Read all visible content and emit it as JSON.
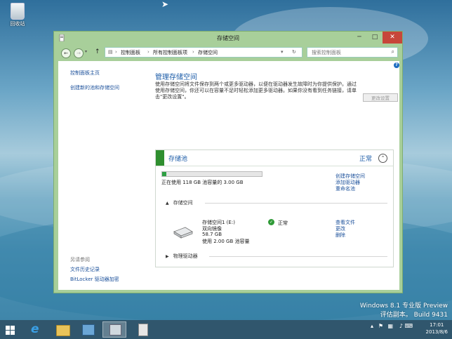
{
  "desktop": {
    "recycle_label": "回收站",
    "watermark_line1": "Windows 8.1 专业版 Preview",
    "watermark_line2": "评估副本。 Build 9431"
  },
  "window": {
    "title": "存储空间",
    "minimize": "─",
    "maximize": "□",
    "close": "✕"
  },
  "address": {
    "crumbs": [
      "控制面板",
      "所有控制面板项",
      "存储空间"
    ],
    "separator": "›",
    "search_placeholder": "搜索控制面板"
  },
  "sidebar": {
    "links": [
      "控制面板主页",
      "创建新的池和存储空间"
    ],
    "see_also_label": "另请参阅",
    "see_also_links": [
      "文件历史记录",
      "BitLocker 驱动器加密"
    ]
  },
  "main": {
    "heading": "管理存储空间",
    "description": "使用存储空间将文件保存到两个或更多驱动器，以便在驱动器发生故障时为你提供保护。通过使用存储空间，你还可以在容量不足时轻松添加更多驱动器。如果你没有看到任务链接，请单击\"更改设置\"。",
    "change_settings": "更改设置"
  },
  "pool": {
    "name": "存储池",
    "status": "正常",
    "usage_fraction": 0.04,
    "usage_text": "正在使用 118 GB 池容量的 3.00 GB",
    "actions": [
      "创建存储空间",
      "添加驱动器",
      "重命名池"
    ],
    "spaces_section": "存储空间",
    "space": {
      "name": "存储空间1 (E:)",
      "type": "双向镜像",
      "size": "58.7 GB",
      "used": "使用 2.00 GB 池容量",
      "status": "正常",
      "actions": [
        "查看文件",
        "更改",
        "删除"
      ]
    },
    "physical_section": "物理驱动器"
  },
  "taskbar": {
    "time": "17:01",
    "date": "2013/8/6"
  }
}
